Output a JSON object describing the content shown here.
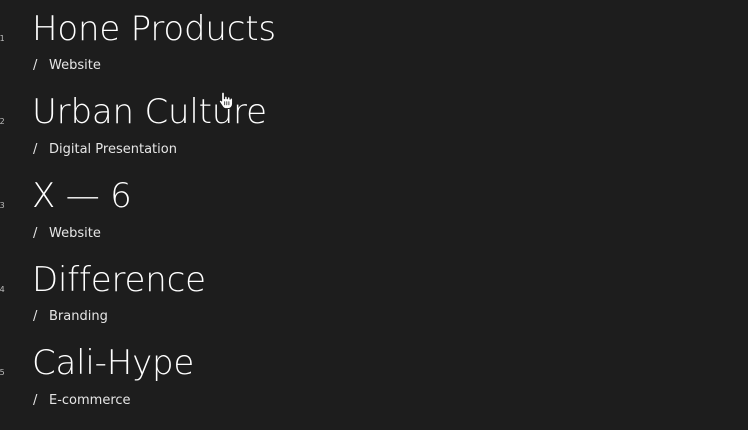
{
  "projects": [
    {
      "number": "01",
      "title": "Hone Products",
      "slash": "/",
      "category": "Website"
    },
    {
      "number": "02",
      "title": "Urban Culture",
      "slash": "/",
      "category": "Digital Presentation"
    },
    {
      "number": "03",
      "title": "X — 6",
      "slash": "/",
      "category": "Website"
    },
    {
      "number": "04",
      "title": "Difference",
      "slash": "/",
      "category": "Branding"
    },
    {
      "number": "05",
      "title": "Cali-Hype",
      "slash": "/",
      "category": "E-commerce"
    }
  ],
  "cursor": {
    "icon": "hand-pointer-icon"
  },
  "colors": {
    "background": "#1d1d1d",
    "text": "#ffffff"
  }
}
